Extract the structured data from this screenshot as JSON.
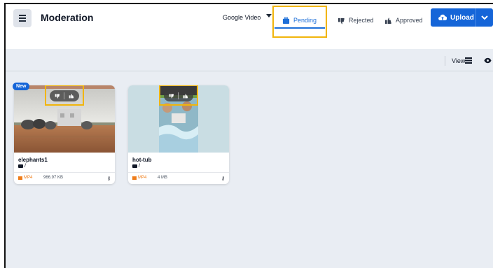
{
  "header": {
    "title": "Moderation",
    "source_dropdown": "Google Video",
    "tabs": [
      {
        "label": "Pending",
        "active": true
      },
      {
        "label": "Rejected",
        "active": false
      },
      {
        "label": "Approved",
        "active": false
      }
    ],
    "upload_label": "Upload"
  },
  "toolbar": {
    "view_label": "View"
  },
  "cards": [
    {
      "name": "elephants1",
      "folder": "/",
      "format": "MP4",
      "size": "966.97 KB",
      "badge": "New"
    },
    {
      "name": "hot-tub",
      "folder": "/",
      "format": "MP4",
      "size": "4 MB"
    }
  ],
  "colors": {
    "accent": "#1565d8",
    "highlight": "#f1b50b",
    "background": "#e9edf3",
    "format": "#ef7d1a"
  }
}
